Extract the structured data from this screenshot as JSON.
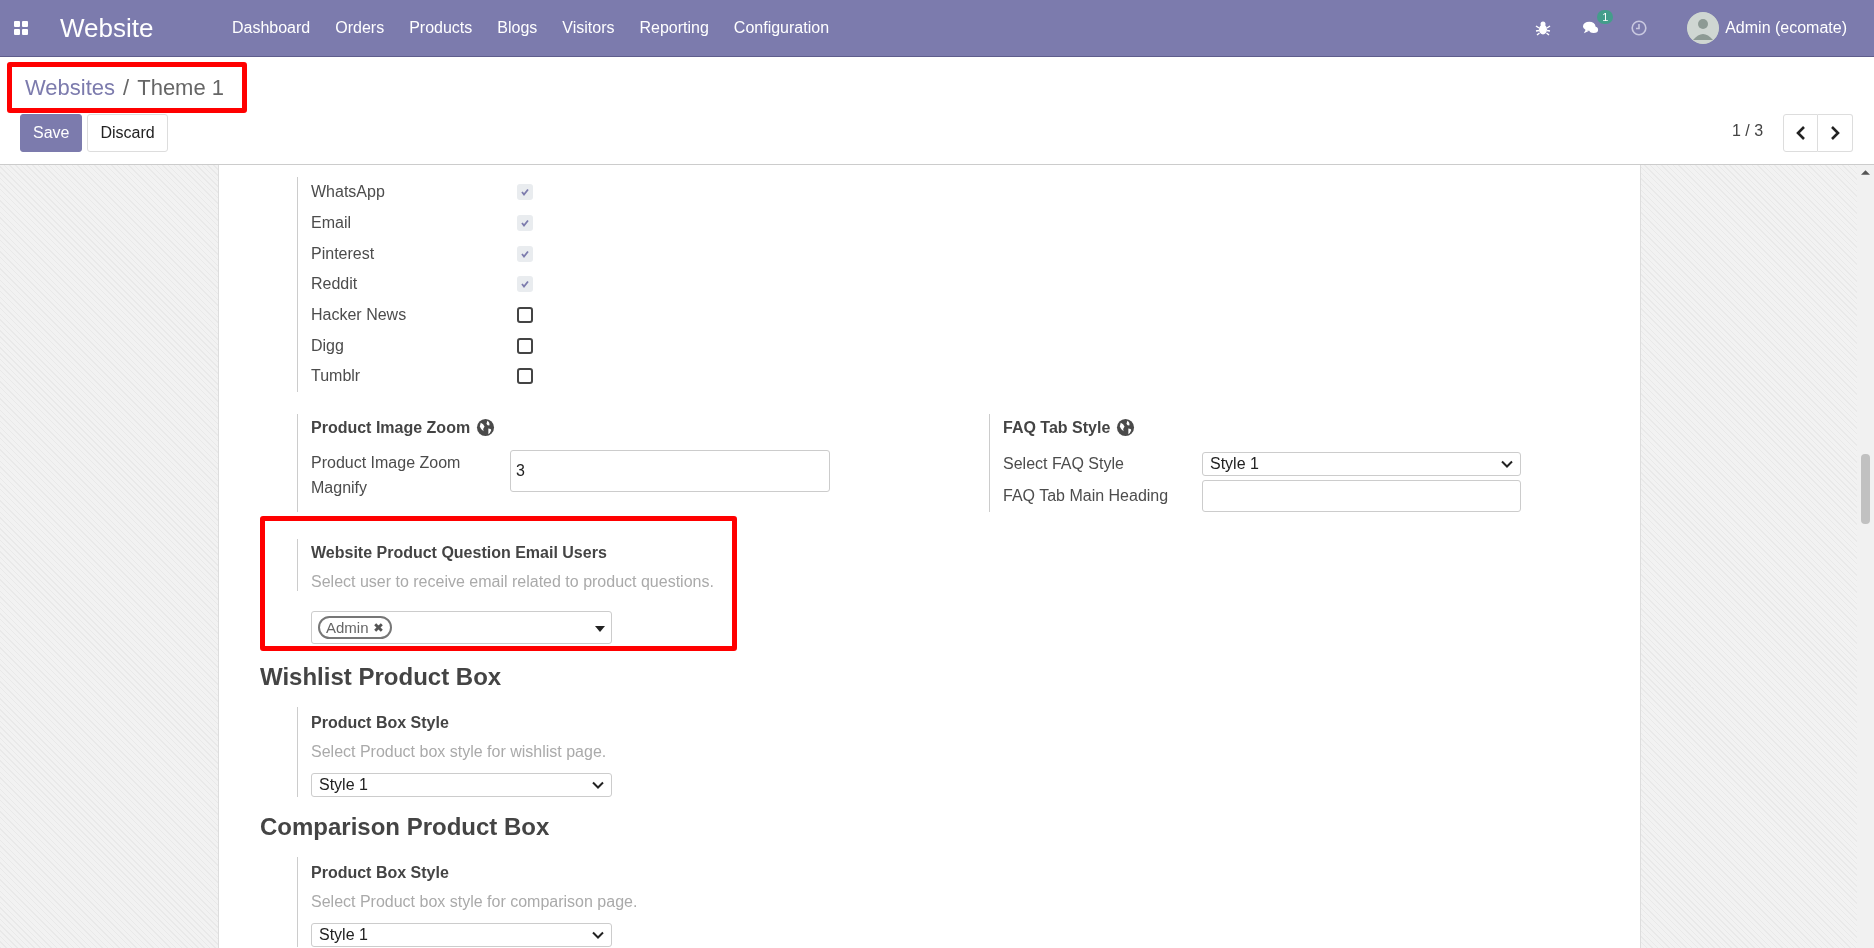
{
  "navbar": {
    "app_title": "Website",
    "menu": [
      "Dashboard",
      "Orders",
      "Products",
      "Blogs",
      "Visitors",
      "Reporting",
      "Configuration"
    ],
    "messages_badge": "1",
    "user": "Admin (ecomate)"
  },
  "breadcrumb": [
    {
      "label": "Websites"
    },
    {
      "label": "Theme 1"
    }
  ],
  "breadcrumb_separator": "/",
  "buttons": [
    {
      "label": "Save",
      "kind": "primary"
    },
    {
      "label": "Discard",
      "kind": "secondary"
    }
  ],
  "pager": "1 / 3",
  "share_options": [
    {
      "label": "WhatsApp",
      "checked": true
    },
    {
      "label": "Email",
      "checked": true
    },
    {
      "label": "Pinterest",
      "checked": true
    },
    {
      "label": "Reddit",
      "checked": true
    },
    {
      "label": "Hacker News",
      "checked": false
    },
    {
      "label": "Digg",
      "checked": false
    },
    {
      "label": "Tumblr",
      "checked": false
    }
  ],
  "product_image_zoom": {
    "title": "Product Image Zoom",
    "field_label": "Product Image Zoom Magnify",
    "value": "3"
  },
  "faq_tab_style": {
    "title": "FAQ Tab Style",
    "fields": [
      {
        "label": "Select FAQ Style",
        "kind": "select",
        "value": "Style 1"
      },
      {
        "label": "FAQ Tab Main Heading",
        "kind": "text"
      }
    ]
  },
  "question_email": {
    "title": "Website Product Question Email Users",
    "description": "Select user to receive email related to product questions.",
    "tags": [
      "Admin"
    ]
  },
  "sections": [
    {
      "heading": "Wishlist Product Box",
      "title": "Product Box Style",
      "description": "Select Product box style for wishlist page.",
      "value": "Style 1"
    },
    {
      "heading": "Comparison Product Box",
      "title": "Product Box Style",
      "description": "Select Product box style for comparison page.",
      "value": "Style 1"
    }
  ]
}
